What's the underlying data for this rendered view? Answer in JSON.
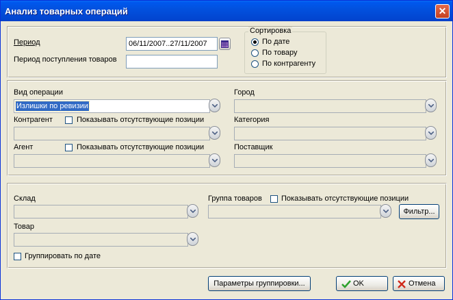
{
  "window": {
    "title": "Анализ товарных операций",
    "close_glyph": "✕"
  },
  "period": {
    "label": "Период",
    "value": "06/11/2007..27/11/2007",
    "receipt_label": "Период поступления товаров",
    "receipt_value": ""
  },
  "sorting": {
    "label": "Сортировка",
    "options": [
      "По дате",
      "По товару",
      "По контрагенту"
    ],
    "selected": "По дате"
  },
  "filters": {
    "operation_type": {
      "label": "Вид операции",
      "value": "Излишки по ревизии"
    },
    "counterparty": {
      "label": "Контрагент",
      "show_missing": "Показывать отсутствующие позиции",
      "value": ""
    },
    "agent": {
      "label": "Агент",
      "show_missing": "Показывать отсутствующие позиции",
      "value": ""
    },
    "city": {
      "label": "Город",
      "value": ""
    },
    "category": {
      "label": "Категория",
      "value": ""
    },
    "supplier": {
      "label": "Поставщик",
      "value": ""
    }
  },
  "goods": {
    "warehouse": {
      "label": "Склад",
      "value": ""
    },
    "product_group": {
      "label": "Группа товаров",
      "show_missing": "Показывать отсутствующие позиции",
      "value": ""
    },
    "filter_button": "Фильтр...",
    "product": {
      "label": "Товар",
      "value": ""
    },
    "group_by_date": "Группировать по дате"
  },
  "buttons": {
    "grouping_params": "Параметры группировки...",
    "ok": "OK",
    "cancel": "Отмена"
  },
  "icons": [
    "close-icon",
    "calendar-icon",
    "chevron-down-icon",
    "checkmark-icon",
    "cross-icon"
  ]
}
